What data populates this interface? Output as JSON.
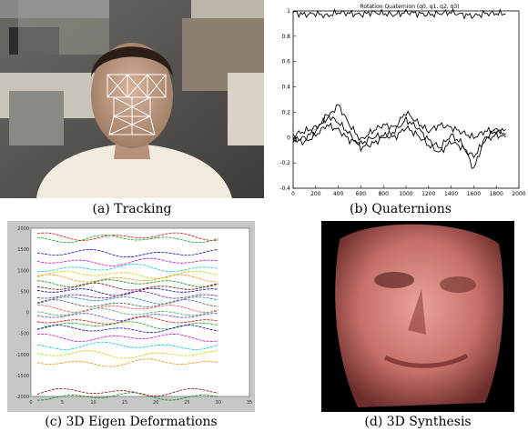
{
  "panels": {
    "a": {
      "caption": "(a) Tracking"
    },
    "b": {
      "caption": "(b) Quaternions",
      "chart_data": {
        "type": "line",
        "title": "Rotation Quaternion (q0, q1, q2, q3)",
        "xlim": [
          0,
          2000
        ],
        "ylim": [
          -0.4,
          1
        ],
        "xticks": [
          "0",
          "200",
          "400",
          "600",
          "800",
          "1000",
          "1200",
          "1400",
          "1600",
          "1800",
          "2000"
        ],
        "yticks": [
          "1",
          "0.8",
          "0.6",
          "0.4",
          "0.2",
          "0",
          "-0.2",
          "-0.4"
        ],
        "series": [
          {
            "values_x": [
              0,
              100,
              200,
              300,
              400,
              500,
              600,
              700,
              800,
              900,
              1000,
              1100,
              1200,
              1300,
              1400,
              1500,
              1600,
              1700,
              1800,
              1900
            ],
            "values_y": [
              0.99,
              0.97,
              0.98,
              0.96,
              0.99,
              0.98,
              0.97,
              0.99,
              0.98,
              0.97,
              0.99,
              0.98,
              0.97,
              0.98,
              0.99,
              0.97,
              0.96,
              0.98,
              0.98,
              0.98
            ]
          },
          {
            "values_x": [
              0,
              100,
              200,
              300,
              400,
              500,
              600,
              700,
              800,
              900,
              1000,
              1100,
              1200,
              1300,
              1400,
              1500,
              1600,
              1700,
              1800,
              1900
            ],
            "values_y": [
              0.02,
              0.05,
              0.08,
              0.15,
              0.26,
              0.1,
              -0.02,
              0.05,
              0.1,
              0.08,
              0.2,
              0.12,
              0.05,
              0.1,
              0.08,
              0.04,
              0.0,
              0.05,
              0.06,
              0.05
            ]
          },
          {
            "values_x": [
              0,
              100,
              200,
              300,
              400,
              500,
              600,
              700,
              800,
              900,
              1000,
              1100,
              1200,
              1300,
              1400,
              1500,
              1600,
              1700,
              1800,
              1900
            ],
            "values_y": [
              -0.03,
              0.0,
              0.05,
              0.18,
              0.12,
              0.03,
              -0.08,
              -0.05,
              0.0,
              0.05,
              0.14,
              0.08,
              -0.02,
              -0.08,
              0.02,
              -0.05,
              -0.25,
              0.0,
              0.05,
              0.03
            ]
          },
          {
            "values_x": [
              0,
              100,
              200,
              300,
              400,
              500,
              600,
              700,
              800,
              900,
              1000,
              1100,
              1200,
              1300,
              1400,
              1500,
              1600,
              1700,
              1800,
              1900
            ],
            "values_y": [
              0.0,
              -0.04,
              0.02,
              0.1,
              0.06,
              -0.02,
              -0.05,
              0.0,
              0.02,
              0.0,
              0.08,
              0.02,
              -0.06,
              -0.12,
              -0.03,
              -0.08,
              -0.15,
              -0.02,
              0.02,
              0.0
            ]
          }
        ]
      }
    },
    "c": {
      "caption": "(c) 3D Eigen Deformations",
      "chart_data": {
        "type": "line",
        "xticks": [
          "0",
          "5",
          "10",
          "15",
          "20",
          "25",
          "30",
          "35"
        ],
        "yticks": [
          "2000",
          "1500",
          "1000",
          "500",
          "0",
          "-500",
          "-1000",
          "-1500",
          "-2000"
        ],
        "xlim": [
          0,
          35
        ],
        "ylim": [
          -2000,
          2000
        ]
      }
    },
    "d": {
      "caption": "(d) 3D Synthesis"
    }
  }
}
